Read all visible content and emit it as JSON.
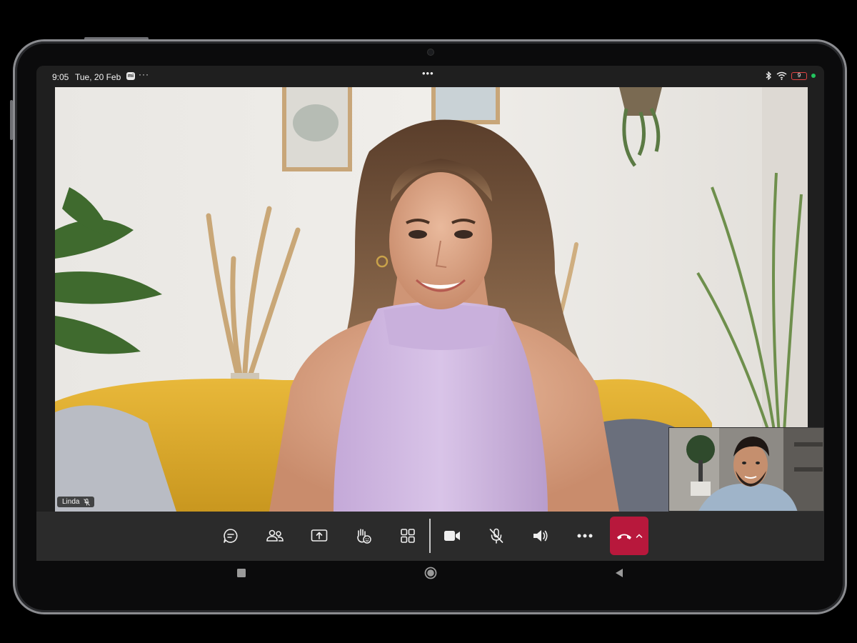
{
  "status_bar": {
    "time": "9:05",
    "date": "Tue, 20 Feb",
    "mi_badge": "mi",
    "left_more": "···",
    "center_more": "•••",
    "battery": "9"
  },
  "call": {
    "main_participant": {
      "name": "Linda",
      "muted": true
    }
  },
  "controls": [
    {
      "id": "chat",
      "icon": "chat-icon"
    },
    {
      "id": "people",
      "icon": "people-icon"
    },
    {
      "id": "share",
      "icon": "share-screen-icon"
    },
    {
      "id": "react",
      "icon": "raise-hand-icon"
    },
    {
      "id": "layout",
      "icon": "grid-icon"
    },
    {
      "id": "camera",
      "icon": "video-camera-icon"
    },
    {
      "id": "mic",
      "icon": "mic-off-icon"
    },
    {
      "id": "speaker",
      "icon": "speaker-icon"
    },
    {
      "id": "more",
      "icon": "more-icon"
    },
    {
      "id": "hangup",
      "icon": "phone-hangup-icon"
    }
  ],
  "colors": {
    "hangup": "#b8183c",
    "battery_low": "#e04444",
    "status_dot": "#22c55e"
  }
}
